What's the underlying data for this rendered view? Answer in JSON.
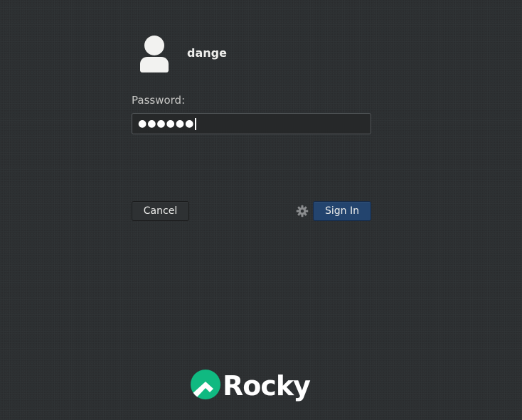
{
  "user": {
    "name": "dange"
  },
  "password": {
    "label": "Password:",
    "masked_value": "●●●●●●"
  },
  "buttons": {
    "cancel_label": "Cancel",
    "signin_label": "Sign In"
  },
  "icons": {
    "avatar": "user-avatar-icon",
    "session": "gear-icon",
    "logo": "rocky-logo-icon"
  },
  "branding": {
    "logo_text": "Rocky",
    "logo_color": "#10b981"
  },
  "colors": {
    "background": "#2c2f31",
    "signin_button": "#23446e",
    "cancel_button": "#2e3133"
  }
}
